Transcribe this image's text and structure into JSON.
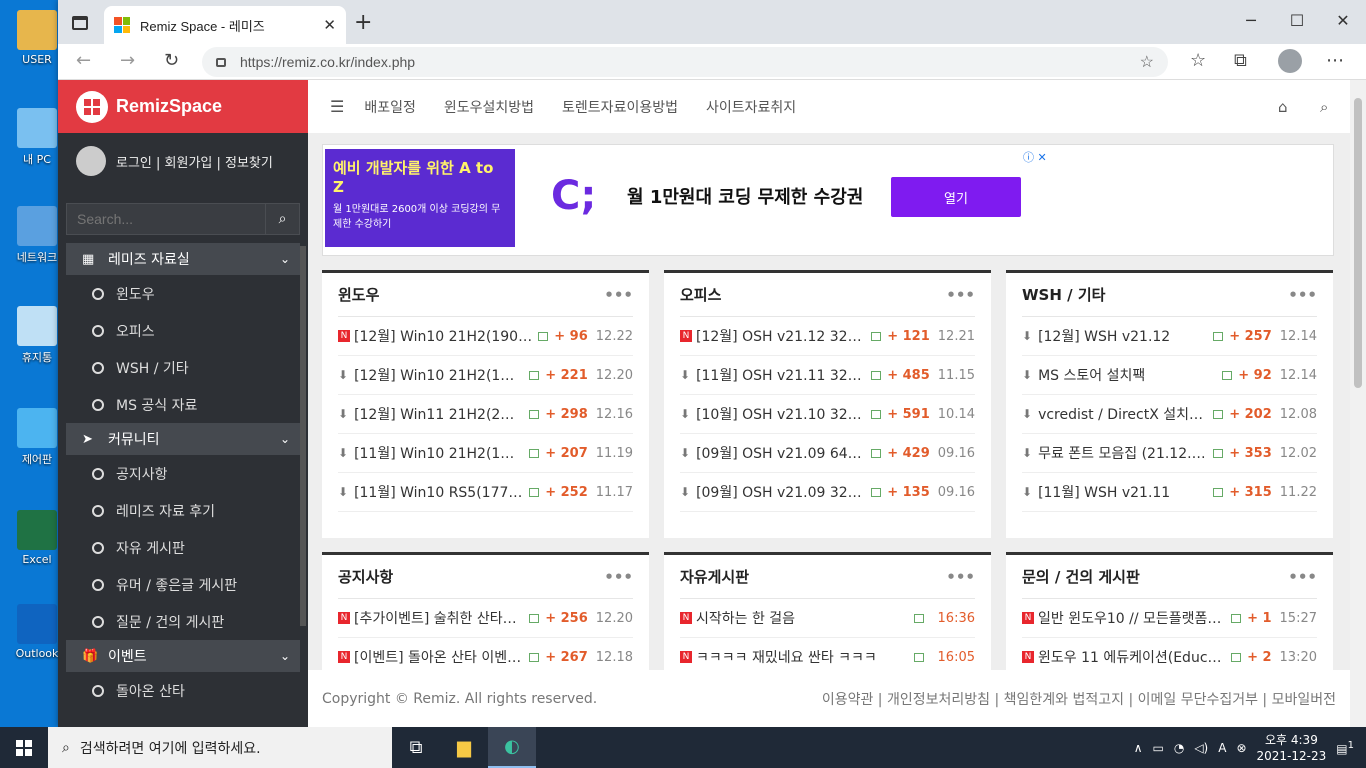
{
  "desktop": {
    "icons": [
      {
        "label": "USER",
        "color": "#e7b64c"
      },
      {
        "label": "내 PC",
        "color": "#7ac0f0"
      },
      {
        "label": "네트워크",
        "color": "#5aa0e0"
      },
      {
        "label": "휴지통",
        "color": "#bfe0f5"
      },
      {
        "label": "제어판",
        "color": "#4cb4f0"
      },
      {
        "label": "Excel",
        "color": "#1f7244"
      },
      {
        "label": "Outlook",
        "color": "#0f64c0"
      }
    ]
  },
  "browser": {
    "tab_title": "Remiz Space - 레미즈",
    "url": "https://remiz.co.kr/index.php"
  },
  "site": {
    "logo": "RemizSpace",
    "login_links": "로그인 | 회원가입 | 정보찾기",
    "search_placeholder": "Search...",
    "menu": [
      {
        "title": "레미즈 자료실",
        "icon": "windows-icon",
        "items": [
          "윈도우",
          "오피스",
          "WSH / 기타",
          "MS 공식 자료"
        ]
      },
      {
        "title": "커뮤니티",
        "icon": "paper-plane-icon",
        "items": [
          "공지사항",
          "레미즈 자료 후기",
          "자유 게시판",
          "유머 / 좋은글 게시판",
          "질문 / 건의 게시판"
        ]
      },
      {
        "title": "이벤트",
        "icon": "gift-icon",
        "items": [
          "돌아온 산타"
        ]
      }
    ],
    "top_nav": [
      "배포일정",
      "윈도우설치방법",
      "토렌트자료이용방법",
      "사이트자료취지"
    ],
    "ad": {
      "image_title": "예비 개발자를 위한 A to Z",
      "image_sub": "월 1만원대로 2600개 이상 코딩강의 무제한 수강하기",
      "text": "월 1만원대 코딩 무제한 수강권",
      "button": "열기"
    },
    "cards": [
      {
        "title": "윈도우",
        "rows": [
          {
            "icon": "N",
            "title": "[12월] Win10 21H2(190…",
            "count": "+ 96",
            "date": "12.22"
          },
          {
            "icon": "dl",
            "title": "[12월] Win10 21H2(1…",
            "count": "+ 221",
            "date": "12.20"
          },
          {
            "icon": "dl",
            "title": "[12월] Win11 21H2(2…",
            "count": "+ 298",
            "date": "12.16"
          },
          {
            "icon": "dl",
            "title": "[11월] Win10 21H2(1…",
            "count": "+ 207",
            "date": "11.19"
          },
          {
            "icon": "dl",
            "title": "[11월] Win10 RS5(177…",
            "count": "+ 252",
            "date": "11.17"
          }
        ]
      },
      {
        "title": "오피스",
        "rows": [
          {
            "icon": "N",
            "title": "[12월] OSH v21.12 32/…",
            "count": "+ 121",
            "date": "12.21"
          },
          {
            "icon": "dl",
            "title": "[11월] OSH v21.11 32…",
            "count": "+ 485",
            "date": "11.15"
          },
          {
            "icon": "dl",
            "title": "[10월] OSH v21.10 32…",
            "count": "+ 591",
            "date": "10.14"
          },
          {
            "icon": "dl",
            "title": "[09월] OSH v21.09 64…",
            "count": "+ 429",
            "date": "09.16"
          },
          {
            "icon": "dl",
            "title": "[09월] OSH v21.09 32…",
            "count": "+ 135",
            "date": "09.16"
          }
        ]
      },
      {
        "title": "WSH / 기타",
        "rows": [
          {
            "icon": "dl",
            "title": "[12월] WSH v21.12",
            "count": "+ 257",
            "date": "12.14"
          },
          {
            "icon": "dl",
            "title": "MS 스토어 설치팩",
            "count": "+ 92",
            "date": "12.14"
          },
          {
            "icon": "dl",
            "title": "vcredist / DirectX 설치 …",
            "count": "+ 202",
            "date": "12.08"
          },
          {
            "icon": "dl",
            "title": "무료 폰트 모음집 (21.12.…",
            "count": "+ 353",
            "date": "12.02"
          },
          {
            "icon": "dl",
            "title": "[11월] WSH v21.11",
            "count": "+ 315",
            "date": "11.22"
          }
        ]
      },
      {
        "title": "공지사항",
        "rows": [
          {
            "icon": "N",
            "title": "[추가이벤트] 술취한 산타에게…",
            "count": "+ 256",
            "date": "12.20"
          },
          {
            "icon": "N",
            "title": "[이벤트] 돌아온 산타 이벤…",
            "count": "+ 267",
            "date": "12.18"
          }
        ]
      },
      {
        "title": "자유게시판",
        "rows": [
          {
            "icon": "N",
            "title": "시작하는 한 걸음",
            "count": "",
            "date": "16:36"
          },
          {
            "icon": "N",
            "title": "ㅋㅋㅋㅋ 재밌네요 싼타 ㅋㅋㅋ",
            "count": "",
            "date": "16:05"
          }
        ]
      },
      {
        "title": "문의 / 건의 게시판",
        "rows": [
          {
            "icon": "N",
            "title": "일반 윈도우10 // 모든플랫폼용 …",
            "count": "+ 1",
            "date": "15:27"
          },
          {
            "icon": "N",
            "title": "윈도우 11 에듀케이션(Educati…",
            "count": "+ 2",
            "date": "13:20"
          }
        ]
      }
    ],
    "footer": {
      "copyright": "Copyright © Remiz. All rights reserved.",
      "links": "이용약관 | 개인정보처리방침 | 책임한계와 법적고지 | 이메일 무단수집거부 | 모바일버전"
    }
  },
  "taskbar": {
    "search_placeholder": "검색하려면 여기에 입력하세요.",
    "time": "오후 4:39",
    "date": "2021-12-23",
    "notifications": "1"
  },
  "colors": {
    "brand": "#e23a42",
    "accent": "#e25c2b",
    "sidebar": "#2d3035"
  }
}
